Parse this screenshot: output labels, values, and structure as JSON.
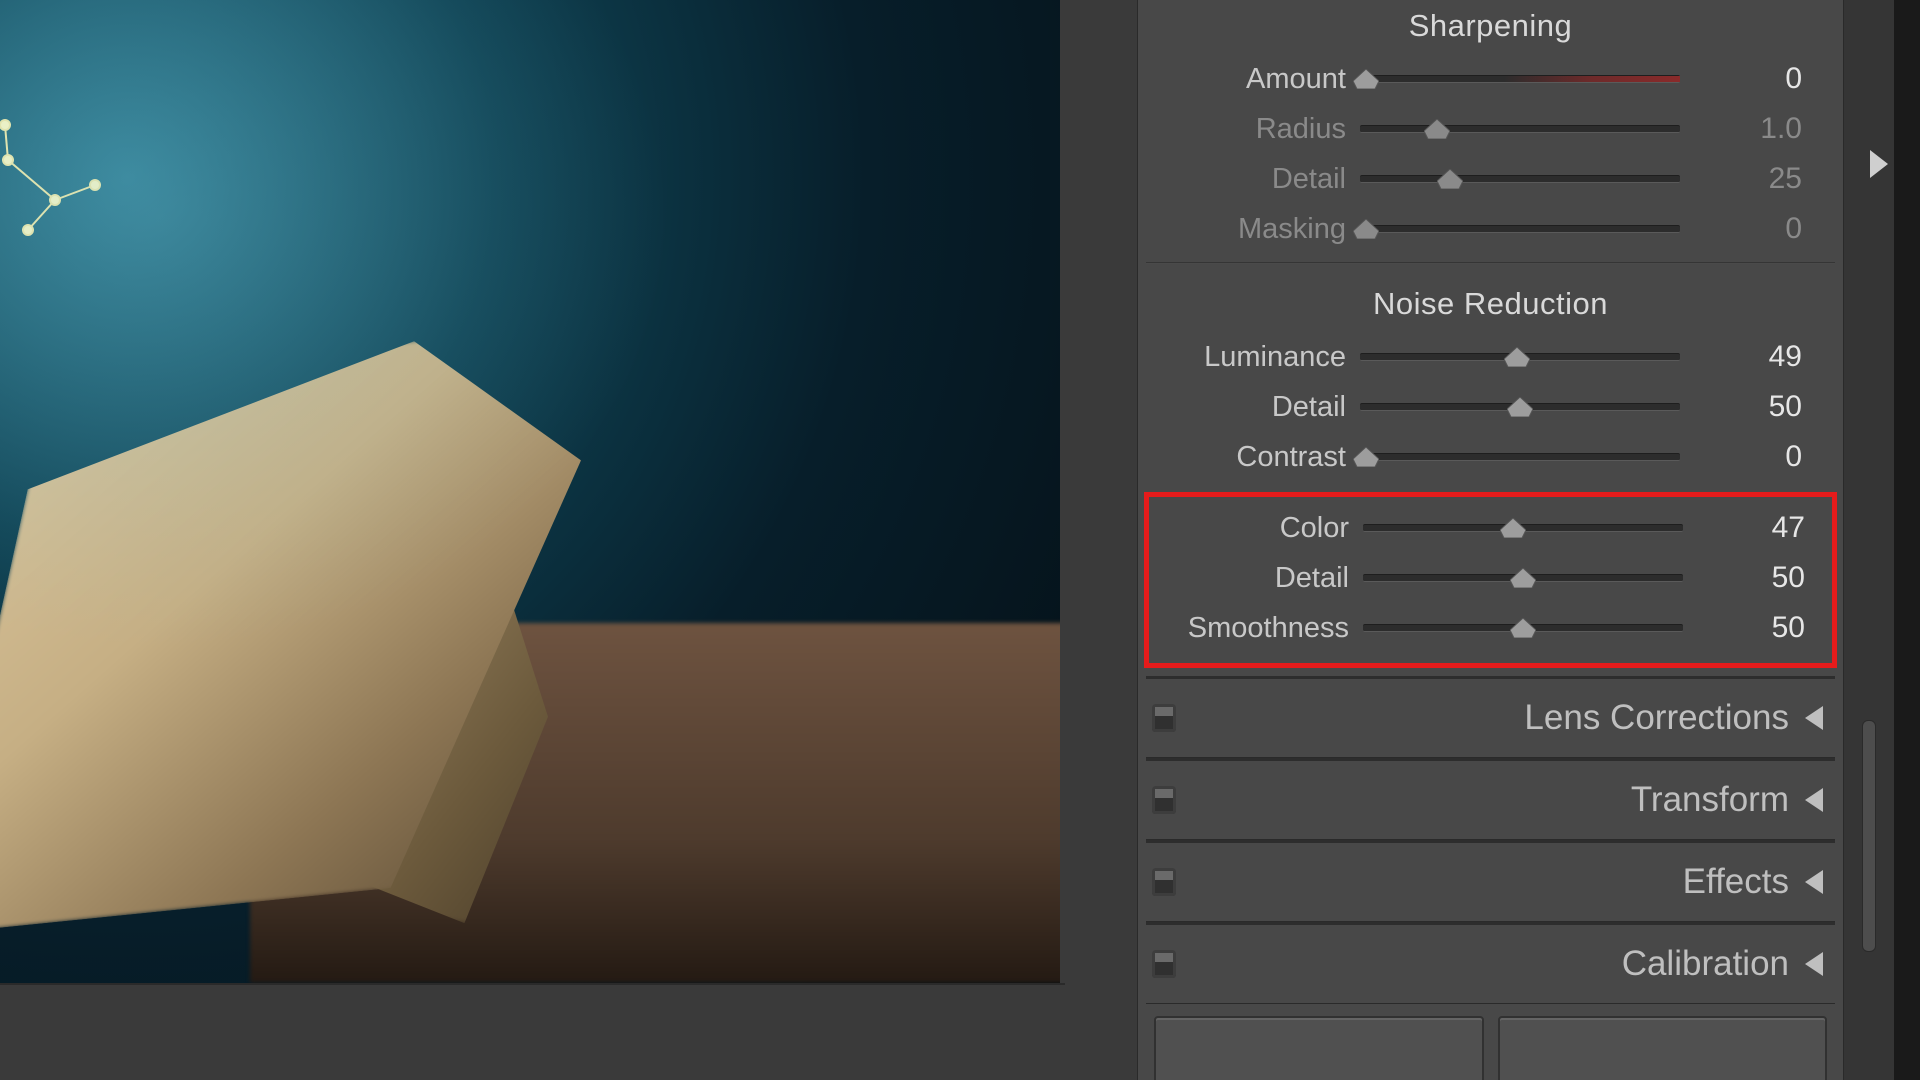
{
  "sharpening": {
    "title": "Sharpening",
    "amount": {
      "label": "Amount",
      "value": "0",
      "pos": 2,
      "tinted": true,
      "dim": false
    },
    "radius": {
      "label": "Radius",
      "value": "1.0",
      "pos": 24,
      "dim": true
    },
    "detail": {
      "label": "Detail",
      "value": "25",
      "pos": 28,
      "dim": true
    },
    "masking": {
      "label": "Masking",
      "value": "0",
      "pos": 2,
      "dim": true
    }
  },
  "noise_reduction": {
    "title": "Noise Reduction",
    "luminance": {
      "label": "Luminance",
      "value": "49",
      "pos": 49
    },
    "lum_detail": {
      "label": "Detail",
      "value": "50",
      "pos": 50
    },
    "contrast": {
      "label": "Contrast",
      "value": "0",
      "pos": 2
    },
    "color": {
      "label": "Color",
      "value": "47",
      "pos": 47
    },
    "col_detail": {
      "label": "Detail",
      "value": "50",
      "pos": 50
    },
    "smoothness": {
      "label": "Smoothness",
      "value": "50",
      "pos": 50
    }
  },
  "collapsed_panels": {
    "lens": "Lens Corrections",
    "transform": "Transform",
    "effects": "Effects",
    "calibration": "Calibration"
  }
}
